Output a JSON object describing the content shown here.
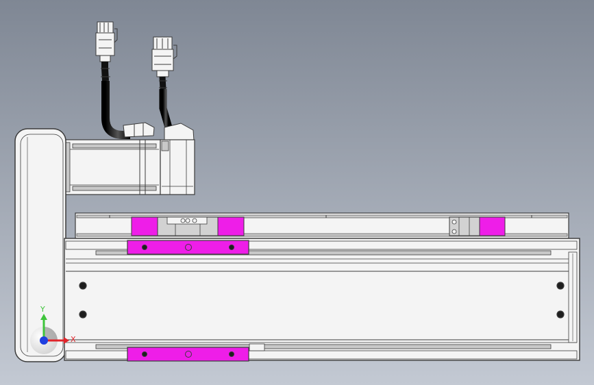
{
  "viewport": {
    "background_top": "#7f8794",
    "background_bottom": "#c3c9d3"
  },
  "model": {
    "body_color": "#f4f4f4",
    "edge_color": "#3a3a3a",
    "slot_color": "#c8c8c8",
    "accent_color": "#ee1ee8",
    "cable_color": "#1e1e1e",
    "block_color": "#d2d2d2"
  },
  "triad": {
    "x_label": "X",
    "y_label": "Y",
    "x_color": "#e0252b",
    "y_color": "#3ec43b",
    "z_color": "#1f3fe0"
  }
}
